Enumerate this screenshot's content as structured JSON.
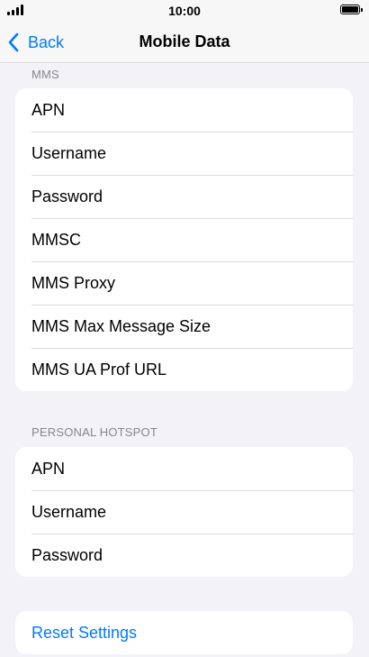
{
  "status_bar": {
    "time": "10:00"
  },
  "nav": {
    "back_label": "Back",
    "title": "Mobile Data"
  },
  "sections": {
    "mms": {
      "header": "MMS",
      "items": [
        "APN",
        "Username",
        "Password",
        "MMSC",
        "MMS Proxy",
        "MMS Max Message Size",
        "MMS UA Prof URL"
      ]
    },
    "hotspot": {
      "header": "PERSONAL HOTSPOT",
      "items": [
        "APN",
        "Username",
        "Password"
      ]
    },
    "reset": {
      "label": "Reset Settings"
    }
  },
  "colors": {
    "accent": "#007aff",
    "background": "#f2f2f7",
    "cell": "#ffffff",
    "secondary_text": "#86868b"
  },
  "icons": {
    "back": "chevron-left-icon",
    "signal": "cellular-signal-icon",
    "battery": "battery-full-icon"
  }
}
